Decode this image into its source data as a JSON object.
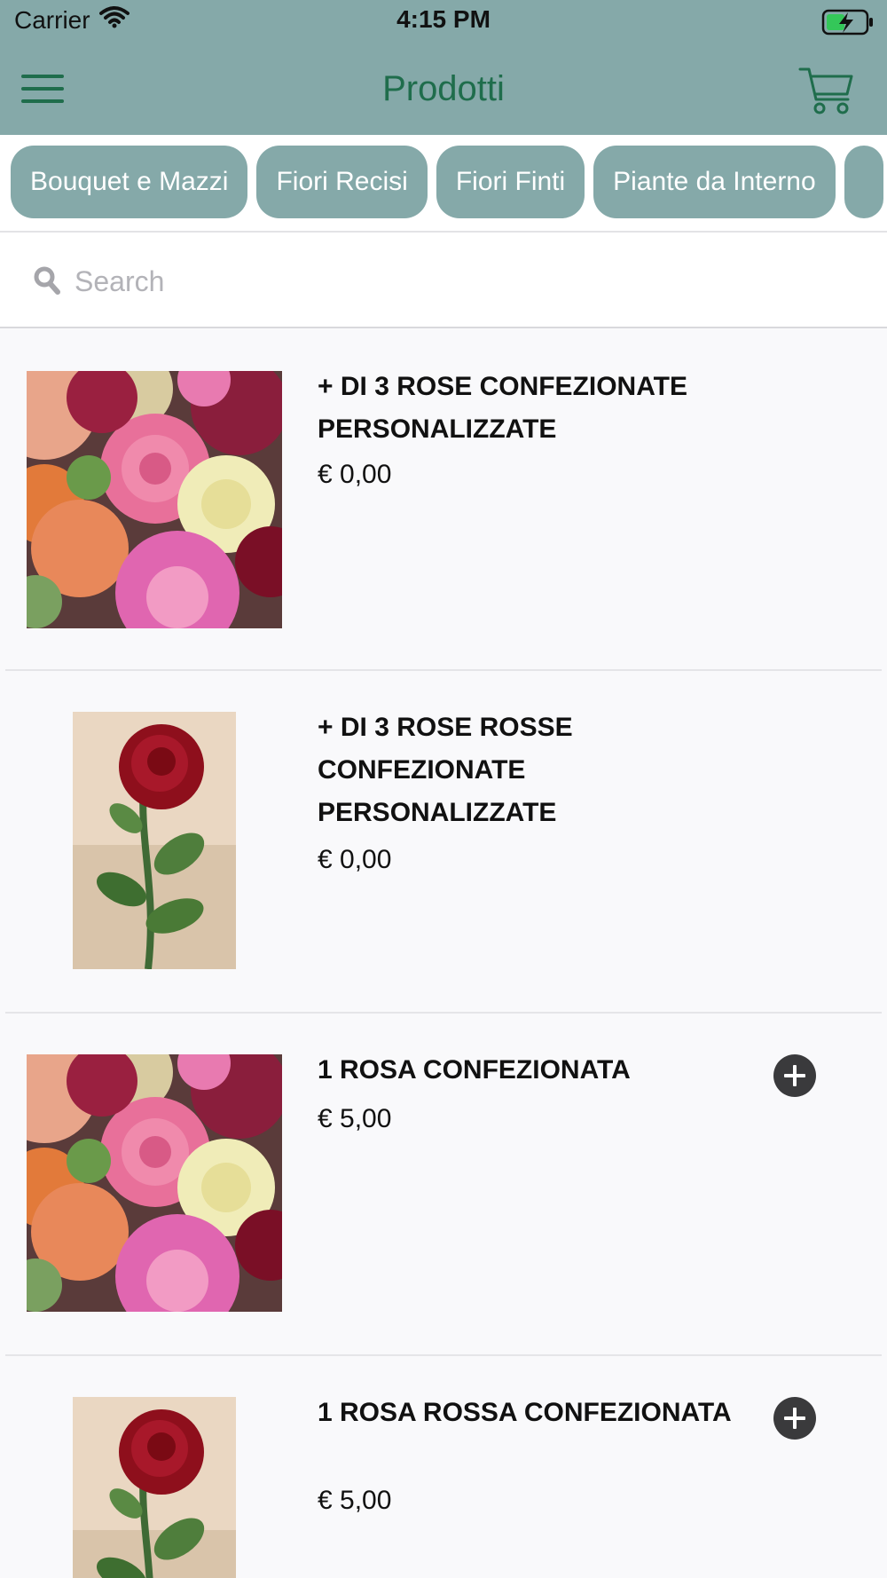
{
  "status_bar": {
    "carrier": "Carrier",
    "time": "4:15 PM"
  },
  "header": {
    "title": "Prodotti",
    "menu_icon": "hamburger-menu-icon",
    "cart_icon": "shopping-cart-icon"
  },
  "categories": [
    {
      "label": "Bouquet e Mazzi"
    },
    {
      "label": "Fiori Recisi"
    },
    {
      "label": "Fiori Finti"
    },
    {
      "label": "Piante da Interno"
    }
  ],
  "search": {
    "placeholder": "Search",
    "value": ""
  },
  "products": [
    {
      "name": "+ DI 3 ROSE CONFEZIONATE PERSONALIZZATE",
      "price": "€ 0,00",
      "image": "mixed-roses-photo",
      "has_add_button": false
    },
    {
      "name": "+ DI 3 ROSE ROSSE CONFEZIONATE PERSONALIZZATE",
      "price": "€ 0,00",
      "image": "single-red-rose-photo",
      "has_add_button": false
    },
    {
      "name": "1 ROSA CONFEZIONATA",
      "price": "€ 5,00",
      "image": "mixed-roses-photo",
      "has_add_button": true
    },
    {
      "name": "1 ROSA ROSSA CONFEZIONATA",
      "price": "€ 5,00",
      "image": "single-red-rose-photo",
      "has_add_button": true
    }
  ],
  "colors": {
    "header_bg": "#85a9a9",
    "title_green": "#1f6d4c",
    "chip_bg": "#85a9a9",
    "add_button": "#3a3a3c"
  }
}
